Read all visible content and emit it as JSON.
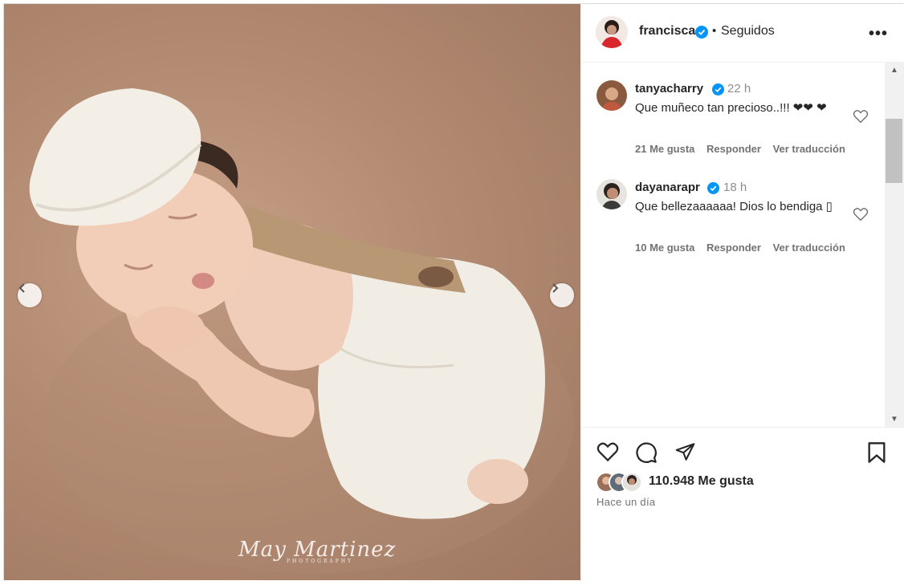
{
  "post": {
    "author": "francisca",
    "follow_status": "Seguidos",
    "more_label": "•••",
    "watermark": "May Martinez",
    "watermark_sub": "PHOTOGRAPHY",
    "likes": "110.948 Me gusta",
    "posted": "Hace un día"
  },
  "comments": [
    {
      "user": "tanyacharry",
      "time": "22 h",
      "text": "Que muñeco tan precioso..!!! ❤❤ ❤",
      "likes": "21 Me gusta",
      "reply": "Responder",
      "translate": "Ver traducción"
    },
    {
      "user": "dayanarapr",
      "time": "18 h",
      "text": "Que bellezaaaaaa! Dios lo bendiga ▯",
      "likes": "10 Me gusta",
      "reply": "Responder",
      "translate": "Ver traducción"
    }
  ],
  "colors": {
    "verified": "#0095f6",
    "text": "#262626",
    "muted": "#737373"
  },
  "icons": [
    "chevron-left-icon",
    "chevron-right-icon",
    "verified-icon",
    "more-icon",
    "heart-icon",
    "comment-icon",
    "share-icon",
    "bookmark-icon"
  ]
}
